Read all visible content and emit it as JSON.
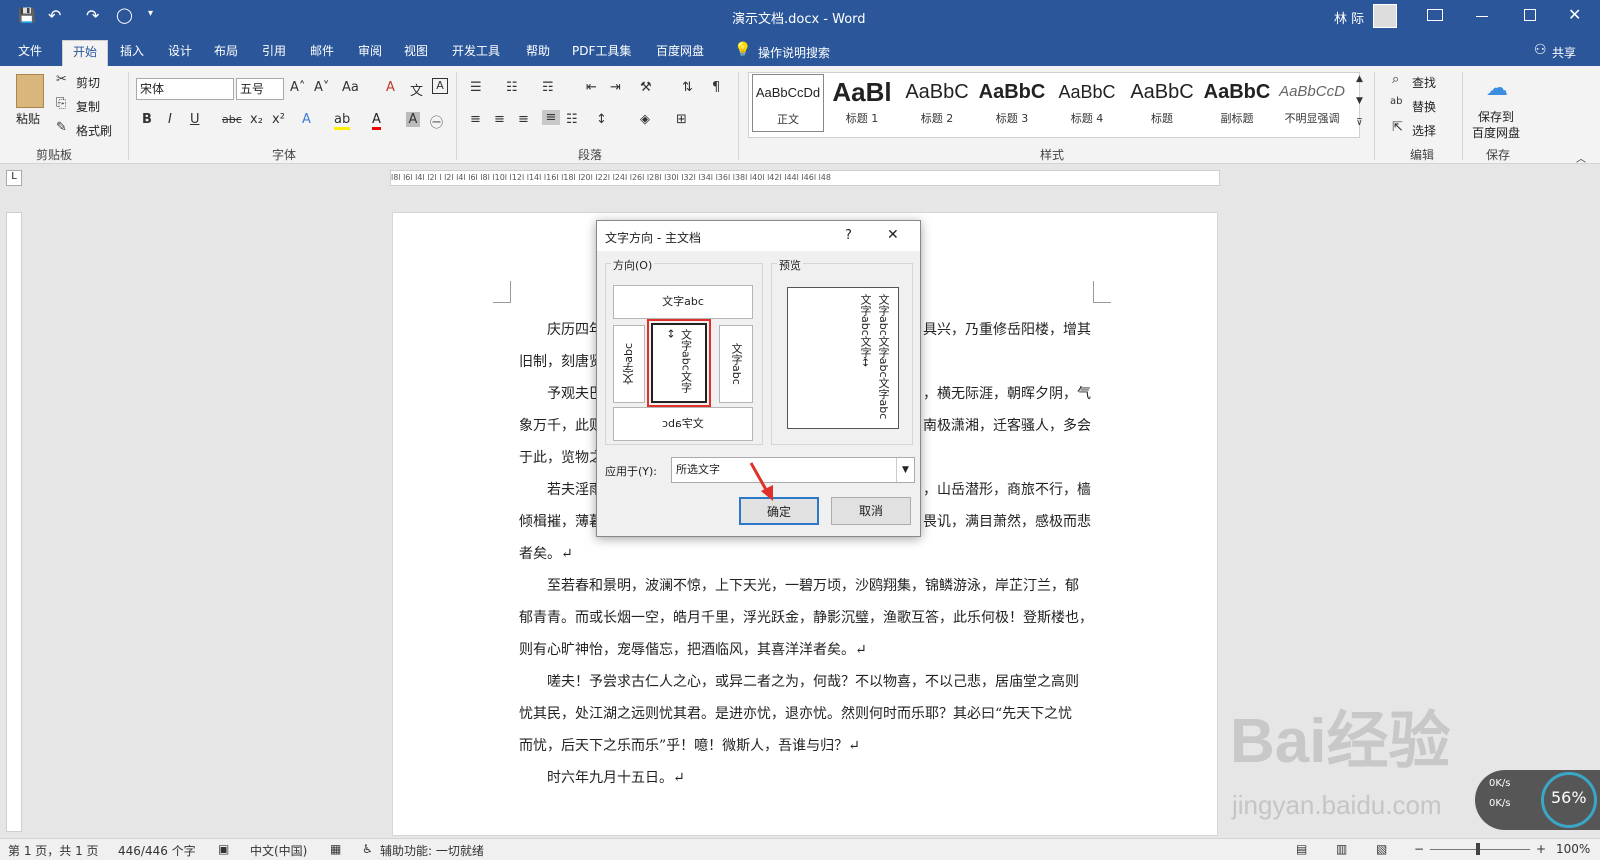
{
  "window": {
    "title": "演示文档.docx - Word",
    "user": "林 际"
  },
  "qat": {
    "save": "💾",
    "undo": "↶",
    "redo": "↷",
    "circle": "◯",
    "more": "▾"
  },
  "tabs": [
    "文件",
    "开始",
    "插入",
    "设计",
    "布局",
    "引用",
    "邮件",
    "审阅",
    "视图",
    "开发工具",
    "帮助",
    "PDF工具集",
    "百度网盘"
  ],
  "tell_me": "操作说明搜索",
  "share": "共享",
  "clipboard": {
    "paste": "粘贴",
    "cut": "剪切",
    "copy": "复制",
    "format_painter": "格式刷",
    "label": "剪贴板"
  },
  "font": {
    "name": "宋体",
    "size": "五号",
    "label": "字体",
    "bold": "B",
    "italic": "I",
    "underline": "U",
    "strike": "abc",
    "sub": "x₂",
    "sup": "x²",
    "grow": "A˄",
    "shrink": "A˅",
    "case": "Aa",
    "clear": "A",
    "pinyin": "文",
    "border": "A"
  },
  "paragraph": {
    "label": "段落"
  },
  "styles": {
    "label": "样式",
    "items": [
      {
        "preview": "AaBbCcDd",
        "name": "正文"
      },
      {
        "preview": "AaBl",
        "name": "标题 1"
      },
      {
        "preview": "AaBbC",
        "name": "标题 2"
      },
      {
        "preview": "AaBbC",
        "name": "标题 3"
      },
      {
        "preview": "AaBbC",
        "name": "标题 4"
      },
      {
        "preview": "AaBbC",
        "name": "标题"
      },
      {
        "preview": "AaBbC",
        "name": "副标题"
      },
      {
        "preview": "AaBbCcD",
        "name": "不明显强调"
      }
    ]
  },
  "editing": {
    "find": "查找",
    "replace": "替换",
    "select": "选择",
    "label": "编辑"
  },
  "save_group": {
    "btn1": "保存到",
    "btn2": "百度网盘",
    "label": "保存"
  },
  "ruler": {
    "marks": "l8l l6l l4l l2l l l2l l4l l6l l8l l10l l12l l14l l16l l18l l20l l22l l24l l26l l28l l30l l32l l34l l36l l38l l40l l42l l44l l46l l48"
  },
  "doc": {
    "lines": [
      "庆历四年",
      "旧制，刻唐贤",
      "予观夫巴",
      "象万千，此则",
      "于此，览物之",
      "若夫淫雨",
      "倾楫摧，薄暮",
      "者矣。↵",
      "至若春和景明，波澜不惊，上下天光，一碧万顷，沙鸥翔集，锦鳞游泳，岸芷汀兰，郁",
      "郁青青。而或长烟一空，皓月千里，浮光跃金，静影沉璧，渔歌互答，此乐何极！登斯楼也，",
      "则有心旷神怡，宠辱偕忘，把酒临风，其喜洋洋者矣。↵",
      "嗟夫！予尝求古仁人之心，或异二者之为，何哉？不以物喜，不以己悲，居庙堂之高则",
      "忧其民，处江湖之远则忧其君。是进亦忧，退亦忧。然则何时而乐耶？其必曰“先天下之忧",
      "而忧，后天下之乐而乐”乎！噫！微斯人，吾谁与归？↵",
      "时六年九月十五日。↵"
    ],
    "right": [
      "具兴，乃重修岳阳楼，增其",
      "，横无际涯，朝晖夕阴，气",
      "南极潇湘，迁客骚人，多会",
      "，山岳潜形，商旅不行，樯",
      "畏讥，满目萧然，感极而悲"
    ]
  },
  "dialog": {
    "title": "文字方向 - 主文档",
    "help": "?",
    "close": "✕",
    "direction_label": "方向(O)",
    "preview_label": "预览",
    "opt_h": "文字abc",
    "opt_v1": "文字abc",
    "opt_v2": "文字abc文字↔",
    "opt_v3": "文字abc",
    "opt_h2": "文字abc",
    "preview_text": "文字abc文字abc文字abc文字abc文字↔",
    "apply_label": "应用于(Y):",
    "apply_value": "所选文字",
    "ok": "确定",
    "cancel": "取消"
  },
  "status": {
    "page": "第 1 页，共 1 页",
    "words": "446/446 个字",
    "lang": "中文(中国)",
    "access": "辅助功能: 一切就绪",
    "zoom": "100%"
  },
  "watermark": {
    "text": "Bai经验",
    "url": "jingyan.baidu.com"
  },
  "speed": {
    "up": "0K/s",
    "down": "0K/s",
    "pct": "56%"
  },
  "colors": {
    "accent": "#2b579a",
    "highlight_red": "#e0302a"
  }
}
